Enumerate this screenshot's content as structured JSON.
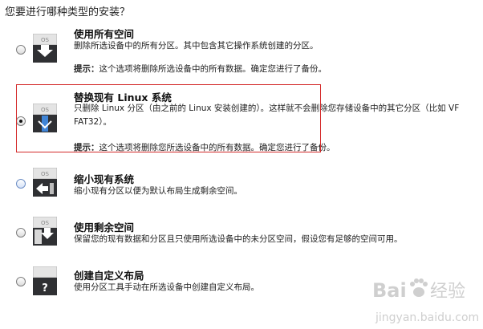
{
  "question": "您要进行哪种类型的安装？",
  "options": [
    {
      "title": "使用所有空间",
      "desc": "删除所选设备中的所有分区。其中包含其它操作系统创建的分区。",
      "hint_label": "提示：",
      "hint": "这个选项将删除所选设备中的所有数据。确定您进行了备份。",
      "icon": "disk-erase-icon",
      "icon_text": "OS",
      "selected": false
    },
    {
      "title": "替换现有 Linux 系统",
      "desc_line1": "只删除 Linux 分区（由之前的 Linux 安装创建的）。这样就不会删除您存储设备中的其它分区（比如 VF",
      "desc_line2": "FAT32）。",
      "hint_label": "提示：",
      "hint": "这个选项将删除您所选设备中的所有数据。确定您进行了备份。",
      "icon": "disk-replace-linux-icon",
      "icon_text": "OS",
      "selected": true
    },
    {
      "title": "缩小现有系统",
      "desc": "缩小现有分区以便为默认布局生成剩余空间。",
      "icon": "disk-shrink-icon",
      "icon_text": "OS",
      "selected": false
    },
    {
      "title": "使用剩余空间",
      "desc": "保留您的现有数据和分区且只使用所选设备中的未分区空间，假设您有足够的空间可用。",
      "icon": "disk-free-space-icon",
      "icon_text": "OS",
      "selected": false
    },
    {
      "title": "创建自定义布局",
      "desc": "使用分区工具手动在所选设备中创建自定义布局。",
      "icon": "disk-custom-layout-icon",
      "icon_text": "?",
      "selected": false
    }
  ],
  "watermark": {
    "brand": "Bai",
    "brand2": "经验",
    "url": "jingyan.baidu.com"
  },
  "colors": {
    "highlight": "#d42a2a",
    "disk_dark": "#2f3033",
    "disk_light": "#d8d8d8",
    "linux_blue": "#3f84d6",
    "watermark": "#c9c9c9"
  }
}
